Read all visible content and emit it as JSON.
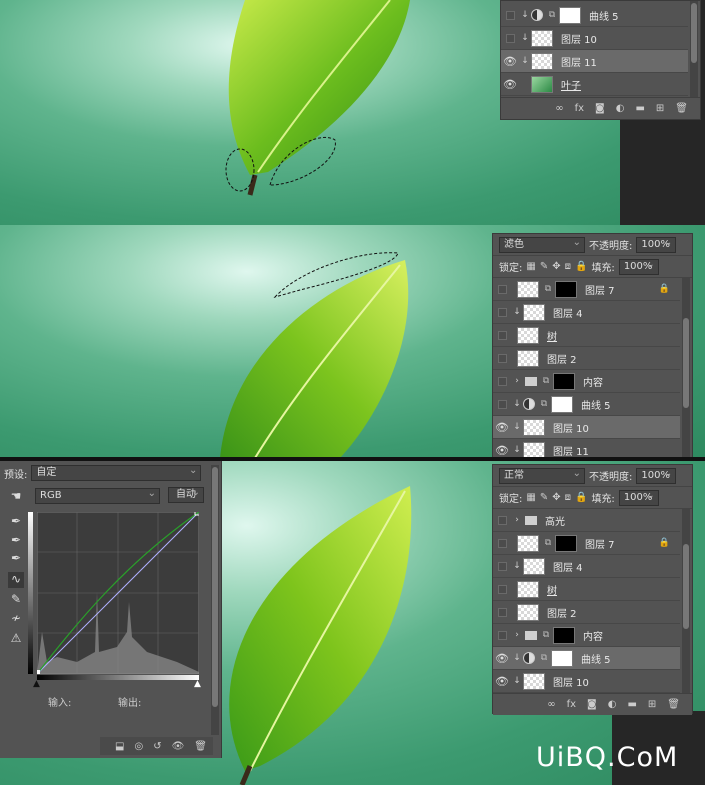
{
  "top_layers": {
    "rows": [
      {
        "name": "曲线 5"
      },
      {
        "name": "图层 10"
      },
      {
        "name": "图层 11"
      },
      {
        "name": "叶子"
      }
    ],
    "footer_fx": "fx"
  },
  "mid_layers": {
    "blend_mode": "滤色",
    "opacity_label": "不透明度:",
    "opacity": "100%",
    "lock_label": "锁定:",
    "fill_label": "填充:",
    "fill": "100%",
    "rows": [
      {
        "name": "图层 7"
      },
      {
        "name": "图层 4"
      },
      {
        "name": "树"
      },
      {
        "name": "图层 2"
      },
      {
        "name": "内容"
      },
      {
        "name": "曲线 5"
      },
      {
        "name": "图层 10"
      },
      {
        "name": "图层 11"
      }
    ]
  },
  "curves": {
    "preset_label": "预设:",
    "preset_value": "自定",
    "channel": "RGB",
    "auto_label": "自动",
    "input_label": "输入:",
    "output_label": "输出:"
  },
  "bottom_layers": {
    "blend_mode": "正常",
    "opacity_label": "不透明度:",
    "opacity": "100%",
    "lock_label": "锁定:",
    "fill_label": "填充:",
    "fill": "100%",
    "rows": [
      {
        "name": "高光"
      },
      {
        "name": "图层 7"
      },
      {
        "name": "图层 4"
      },
      {
        "name": "树"
      },
      {
        "name": "图层 2"
      },
      {
        "name": "内容"
      },
      {
        "name": "曲线 5"
      },
      {
        "name": "图层 10"
      }
    ],
    "footer_fx": "fx"
  },
  "watermark": "UiBQ.CoM"
}
